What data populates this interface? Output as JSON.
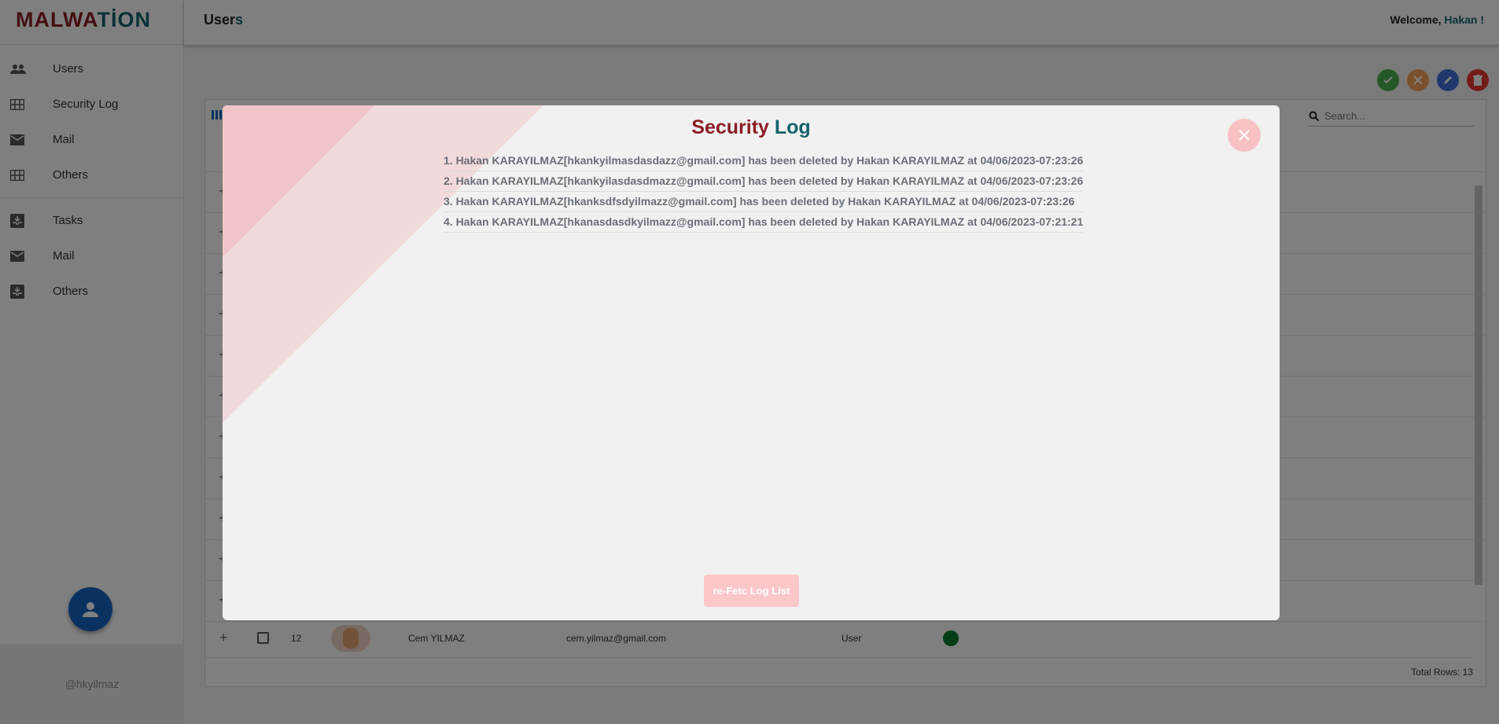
{
  "brand": {
    "part1": "MALWA",
    "part2": "TİON"
  },
  "sidebar": {
    "items": [
      {
        "label": "Users",
        "icon": "people-icon"
      },
      {
        "label": "Security Log",
        "icon": "grid-icon"
      },
      {
        "label": "Mail",
        "icon": "mail-icon"
      },
      {
        "label": "Others",
        "icon": "grid-icon"
      }
    ],
    "items2": [
      {
        "label": "Tasks",
        "icon": "inbox-icon"
      },
      {
        "label": "Mail",
        "icon": "mail-icon"
      },
      {
        "label": "Others",
        "icon": "inbox-icon"
      }
    ],
    "footer": "@hkyilmaz"
  },
  "header": {
    "title_part1": "User",
    "title_part2": "s",
    "welcome_prefix": "Welcome, ",
    "welcome_name": "Hakan !"
  },
  "search": {
    "placeholder": "Search..."
  },
  "table": {
    "last_row": {
      "id": "12",
      "name": "Cem YILMAZ",
      "email": "cem.yilmaz@gmail.com",
      "role": "User"
    },
    "total_rows": "Total Rows: 13"
  },
  "modal": {
    "title_part1": "Security ",
    "title_part2": "Log",
    "entries": [
      "1. Hakan KARAYILMAZ[hkankyilmasdasdazz@gmail.com] has been deleted by Hakan KARAYILMAZ at 04/06/2023-07:23:26",
      "2. Hakan KARAYILMAZ[hkankyilasdasdmazz@gmail.com] has been deleted by Hakan KARAYILMAZ at 04/06/2023-07:23:26",
      "3. Hakan KARAYILMAZ[hkanksdfsdyilmazz@gmail.com] has been deleted by Hakan KARAYILMAZ at 04/06/2023-07:23:26",
      "4. Hakan KARAYILMAZ[hkanasdasdkyilmazz@gmail.com] has been deleted by Hakan KARAYILMAZ at 04/06/2023-07:21:21"
    ],
    "refetch_label": "re-Fetc Log List"
  },
  "colors": {
    "brand_red": "#8a1f24",
    "brand_teal": "#14636c",
    "fab_blue": "#1565c0",
    "approve": "#4caf50",
    "reject": "#f5a05a",
    "edit": "#3f6fd8",
    "delete": "#e53935"
  }
}
